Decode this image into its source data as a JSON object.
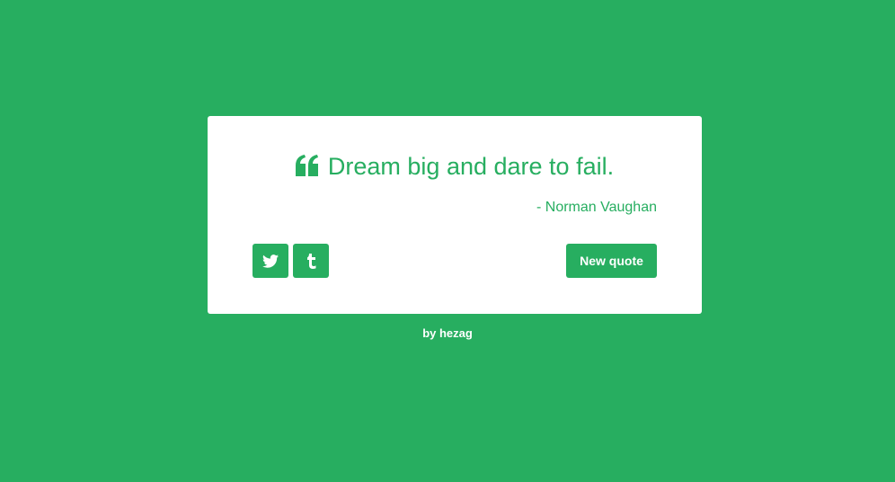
{
  "colors": {
    "background": "#27ae60",
    "card": "#ffffff",
    "accent": "#27ae60"
  },
  "quote": {
    "icon": "quote-left-icon",
    "text": "Dream big and dare to fail.",
    "author": "- Norman Vaughan"
  },
  "actions": {
    "twitter_icon": "twitter-icon",
    "tumblr_icon": "tumblr-icon",
    "new_quote_label": "New quote"
  },
  "footer": {
    "text": "by hezag"
  }
}
